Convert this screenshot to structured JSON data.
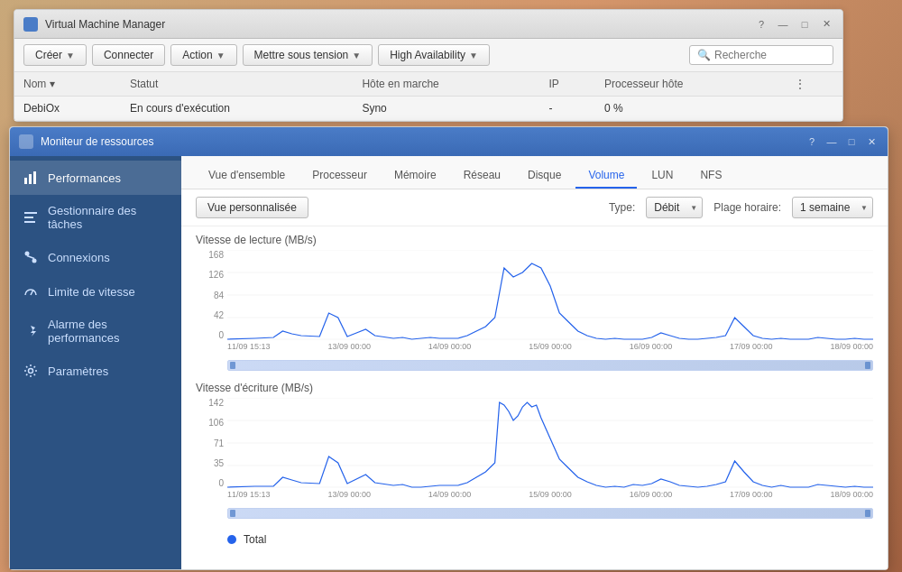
{
  "vmm": {
    "title": "Virtual Machine Manager",
    "controls": [
      "?",
      "—",
      "□",
      "✕"
    ],
    "toolbar": {
      "creer": "Créer",
      "connecter": "Connecter",
      "action": "Action",
      "mettre_sous_tension": "Mettre sous tension",
      "high_availability": "High Availability",
      "search_placeholder": "Recherche"
    },
    "table": {
      "headers": [
        "Nom ▾",
        "Statut",
        "Hôte en marche",
        "IP",
        "Processeur hôte",
        "⋮"
      ],
      "rows": [
        {
          "nom": "DebiOx",
          "statut": "En cours d'exécution",
          "hote": "Syno",
          "ip": "-",
          "processeur": "0 %"
        }
      ]
    }
  },
  "monitor": {
    "title": "Moniteur de ressources",
    "controls": [
      "?",
      "—",
      "□",
      "✕"
    ],
    "tabs": [
      {
        "id": "vue-ensemble",
        "label": "Vue d'ensemble"
      },
      {
        "id": "processeur",
        "label": "Processeur"
      },
      {
        "id": "memoire",
        "label": "Mémoire"
      },
      {
        "id": "reseau",
        "label": "Réseau"
      },
      {
        "id": "disque",
        "label": "Disque"
      },
      {
        "id": "volume",
        "label": "Volume"
      },
      {
        "id": "lun",
        "label": "LUN"
      },
      {
        "id": "nfs",
        "label": "NFS"
      }
    ],
    "active_tab": "volume",
    "controls_bar": {
      "vue_personnalisee": "Vue personnalisée",
      "type_label": "Type:",
      "type_value": "Débit",
      "plage_label": "Plage horaire:",
      "plage_value": "1 semaine"
    },
    "sidebar": {
      "items": [
        {
          "id": "performances",
          "label": "Performances",
          "icon": "chart-icon"
        },
        {
          "id": "gestionnaire-taches",
          "label": "Gestionnaire des tâches",
          "icon": "tasks-icon"
        },
        {
          "id": "connexions",
          "label": "Connexions",
          "icon": "connections-icon"
        },
        {
          "id": "limite-vitesse",
          "label": "Limite de vitesse",
          "icon": "speed-icon"
        },
        {
          "id": "alarme-performances",
          "label": "Alarme des performances",
          "icon": "alarm-icon"
        },
        {
          "id": "parametres",
          "label": "Paramètres",
          "icon": "settings-icon"
        }
      ]
    },
    "charts": {
      "read": {
        "title": "Vitesse de lecture (MB/s)",
        "y_labels": [
          "168",
          "126",
          "84",
          "42",
          "0"
        ],
        "x_labels": [
          "11/09 15:13",
          "13/09 00:00",
          "14/09 00:00",
          "15/09 00:00",
          "16/09 00:00",
          "17/09 00:00",
          "18/09 00:00"
        ]
      },
      "write": {
        "title": "Vitesse d'écriture (MB/s)",
        "y_labels": [
          "142",
          "106",
          "71",
          "35",
          "0"
        ],
        "x_labels": [
          "11/09 15:13",
          "13/09 00:00",
          "14/09 00:00",
          "15/09 00:00",
          "16/09 00:00",
          "17/09 00:00",
          "18/09 00:00"
        ]
      }
    },
    "legend": {
      "color": "#2563eb",
      "label": "Total"
    }
  }
}
